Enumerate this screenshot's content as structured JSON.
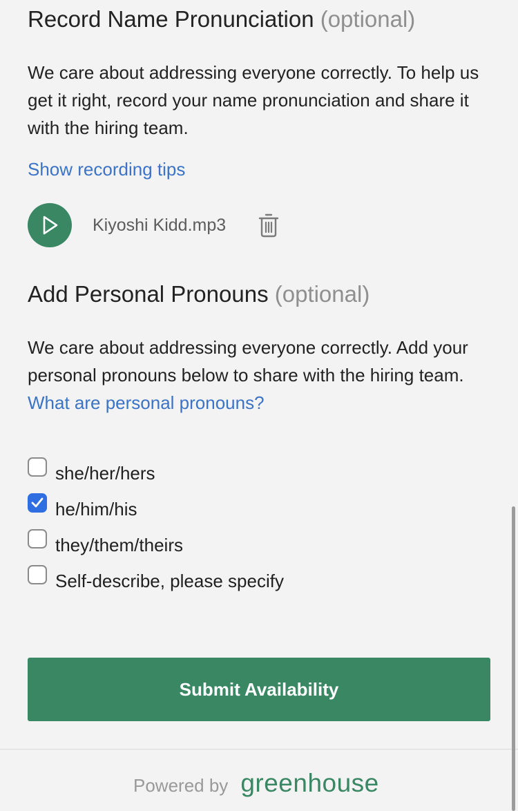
{
  "pronunciation": {
    "title": "Record Name Pronunciation",
    "optional": "(optional)",
    "description": "We care about addressing everyone correctly. To help us get it right, record your name pronunciation and share it with the hiring team.",
    "tips_link": "Show recording tips",
    "file_name": "Kiyoshi Kidd.mp3",
    "play_icon": "play-icon",
    "delete_icon": "trash-icon"
  },
  "pronouns": {
    "title": "Add Personal Pronouns",
    "optional": "(optional)",
    "description": "We care about addressing everyone correctly. Add your personal pronouns below to share with the hiring team.",
    "help_link": "What are personal pronouns?",
    "options": [
      {
        "label": "she/her/hers",
        "checked": false
      },
      {
        "label": "he/him/his",
        "checked": true
      },
      {
        "label": "they/them/theirs",
        "checked": false
      },
      {
        "label": "Self-describe, please specify",
        "checked": false
      }
    ]
  },
  "submit": {
    "label": "Submit Availability"
  },
  "footer": {
    "powered_by": "Powered by",
    "brand": "greenhouse"
  },
  "colors": {
    "accent_green": "#3a8764",
    "link_blue": "#3b73c6",
    "checkbox_blue": "#2f6ee0",
    "background": "#f3f3f3"
  }
}
